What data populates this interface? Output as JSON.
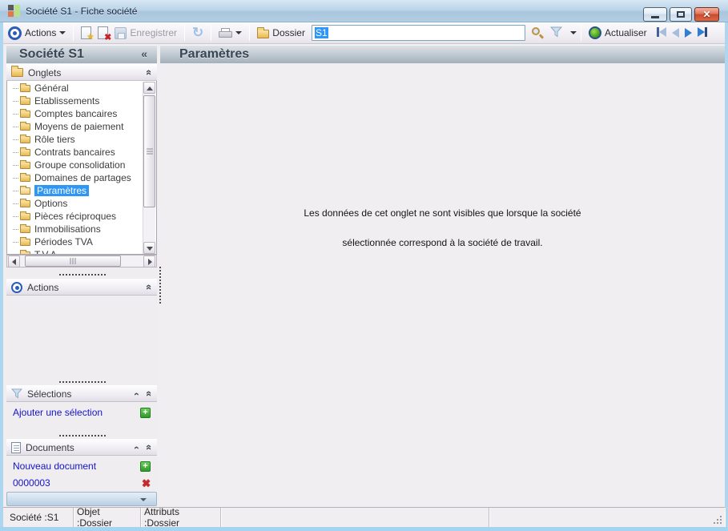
{
  "window": {
    "title": "Société S1 -  Fiche société"
  },
  "toolbar": {
    "actions": "Actions",
    "enregistrer": "Enregistrer",
    "dossier": "Dossier",
    "search_value": "S1",
    "actualiser": "Actualiser"
  },
  "left_panel": {
    "title": "Société S1",
    "collapse_glyph": "«",
    "sections": {
      "onglets": "Onglets",
      "actions": "Actions",
      "selections": "Sélections",
      "documents": "Documents"
    },
    "selections": {
      "add_link": "Ajouter une sélection"
    },
    "documents": {
      "new_link": "Nouveau document",
      "doc_number": "0000003"
    }
  },
  "tree": {
    "items": [
      {
        "label": "Général"
      },
      {
        "label": "Etablissements"
      },
      {
        "label": "Comptes bancaires"
      },
      {
        "label": "Moyens de paiement"
      },
      {
        "label": "Rôle tiers"
      },
      {
        "label": "Contrats bancaires"
      },
      {
        "label": "Groupe consolidation"
      },
      {
        "label": "Domaines de partages"
      },
      {
        "label": "Paramètres",
        "selected": true
      },
      {
        "label": "Options"
      },
      {
        "label": "Pièces réciproques"
      },
      {
        "label": "Immobilisations"
      },
      {
        "label": "Périodes TVA"
      },
      {
        "label": "T.V.A."
      }
    ]
  },
  "main": {
    "title": "Paramètres",
    "message_line1": "Les données de cet onglet ne sont visibles que lorsque la société",
    "message_line2": "sélectionnée correspond à la société de travail."
  },
  "status_bar": {
    "societe": "Société :S1",
    "objet": "Objet :Dossier",
    "attributs": "Attributs :Dossier"
  },
  "colors": {
    "selection_blue": "#2e96f5",
    "link_blue": "#1414c8",
    "header_text": "#3a4654",
    "folder_yellow": "#e9b850"
  }
}
